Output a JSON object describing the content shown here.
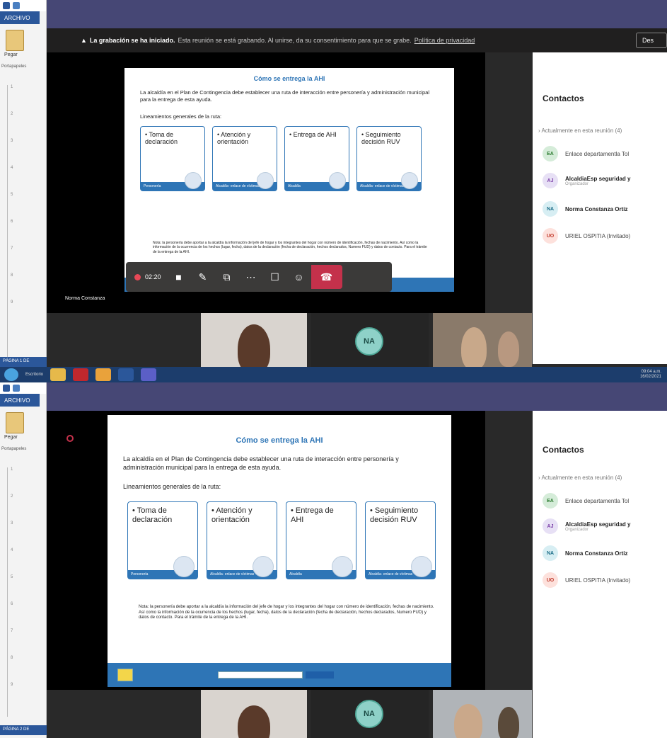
{
  "word": {
    "archivo": "ARCHIVO",
    "pegar": "Pegar",
    "portapapeles": "Portapapeles",
    "page1": "PÁGINA 1 DE",
    "page2": "PÁGINA 2 DE"
  },
  "teams": {
    "banner_bold": "La grabación se ha iniciado.",
    "banner_text": "Esta reunión se está grabando. Al unirse, da su consentimiento para que se grabe.",
    "banner_link": "Política de privacidad",
    "banner_btn": "Des",
    "call_timer": "02:20",
    "presenter_tag": "Norma Constanza"
  },
  "slide": {
    "title": "Cómo se entrega la AHI",
    "intro": "La alcaldía en el Plan de Contingencia debe establecer una ruta de interacción entre personería y administración municipal para la entrega de esta ayuda.",
    "subtitle": "Lineamientos generales de la ruta:",
    "boxes": [
      {
        "text": "• Toma de declaración",
        "footer": "Personería"
      },
      {
        "text": "• Atención y orientación",
        "footer": "Alcaldía- enlace de víctimas"
      },
      {
        "text": "• Entrega de AHI",
        "footer": "Alcaldía"
      },
      {
        "text": "• Seguimiento decisión RUV",
        "footer": "Alcaldía- enlace de víctimas"
      }
    ],
    "note": "Nota: la personería debe aportar a la alcaldía la información del jefe de hogar y los integrantes del hogar con número de identificación, fechas de nacimiento. Así como la información de la ocurrencia de los hechos (lugar, fecha), datos de la declaración (fecha de declaración, hechos declarados, Numero FUD) y datos de contacto. Para el trámite de la entrega de la AHI."
  },
  "panel": {
    "title": "Contactos",
    "group": "Actualmente en esta reunión (4)",
    "people": [
      {
        "initials": "EA",
        "name": "Enlace departamentla Tol",
        "sub": "",
        "bold": false,
        "bg": "#d5ecd9",
        "fg": "#2e7d32"
      },
      {
        "initials": "AJ",
        "name": "AlcaldiaEsp seguridad y",
        "sub": "Organizador",
        "bold": true,
        "bg": "#e7e0f5",
        "fg": "#7b3fa8"
      },
      {
        "initials": "NA",
        "name": "Norma Constanza Ortiz",
        "sub": "",
        "bold": true,
        "bg": "#d7eef3",
        "fg": "#1e6f8a"
      },
      {
        "initials": "UO",
        "name": "URIEL OSPITIA (Invitado)",
        "sub": "",
        "bold": false,
        "bg": "#fde1dc",
        "fg": "#c0392b"
      }
    ]
  },
  "tiles": {
    "na_initials": "NA"
  },
  "taskbar": {
    "label": "Escritorio",
    "time": "09:04 a.m.",
    "date": "16/02/2021"
  }
}
